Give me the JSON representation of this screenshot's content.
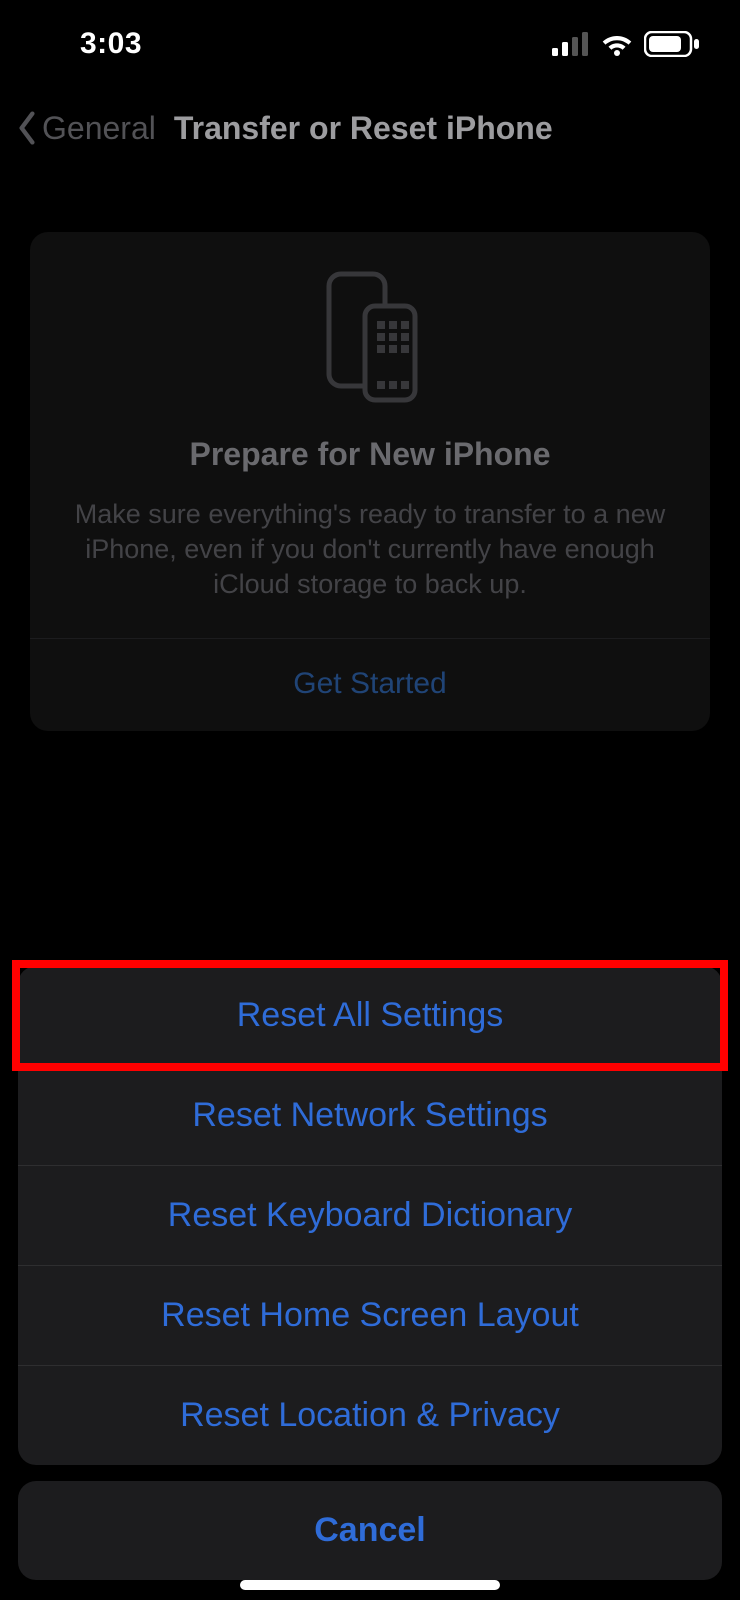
{
  "statusBar": {
    "time": "3:03"
  },
  "nav": {
    "back": "General",
    "title": "Transfer or Reset iPhone"
  },
  "prepareCard": {
    "title": "Prepare for New iPhone",
    "description": "Make sure everything's ready to transfer to a new iPhone, even if you don't currently have enough iCloud storage to back up.",
    "action": "Get Started"
  },
  "sheet": {
    "items": [
      "Reset All Settings",
      "Reset Network Settings",
      "Reset Keyboard Dictionary",
      "Reset Home Screen Layout",
      "Reset Location & Privacy"
    ],
    "cancel": "Cancel"
  },
  "highlightIndex": 0
}
